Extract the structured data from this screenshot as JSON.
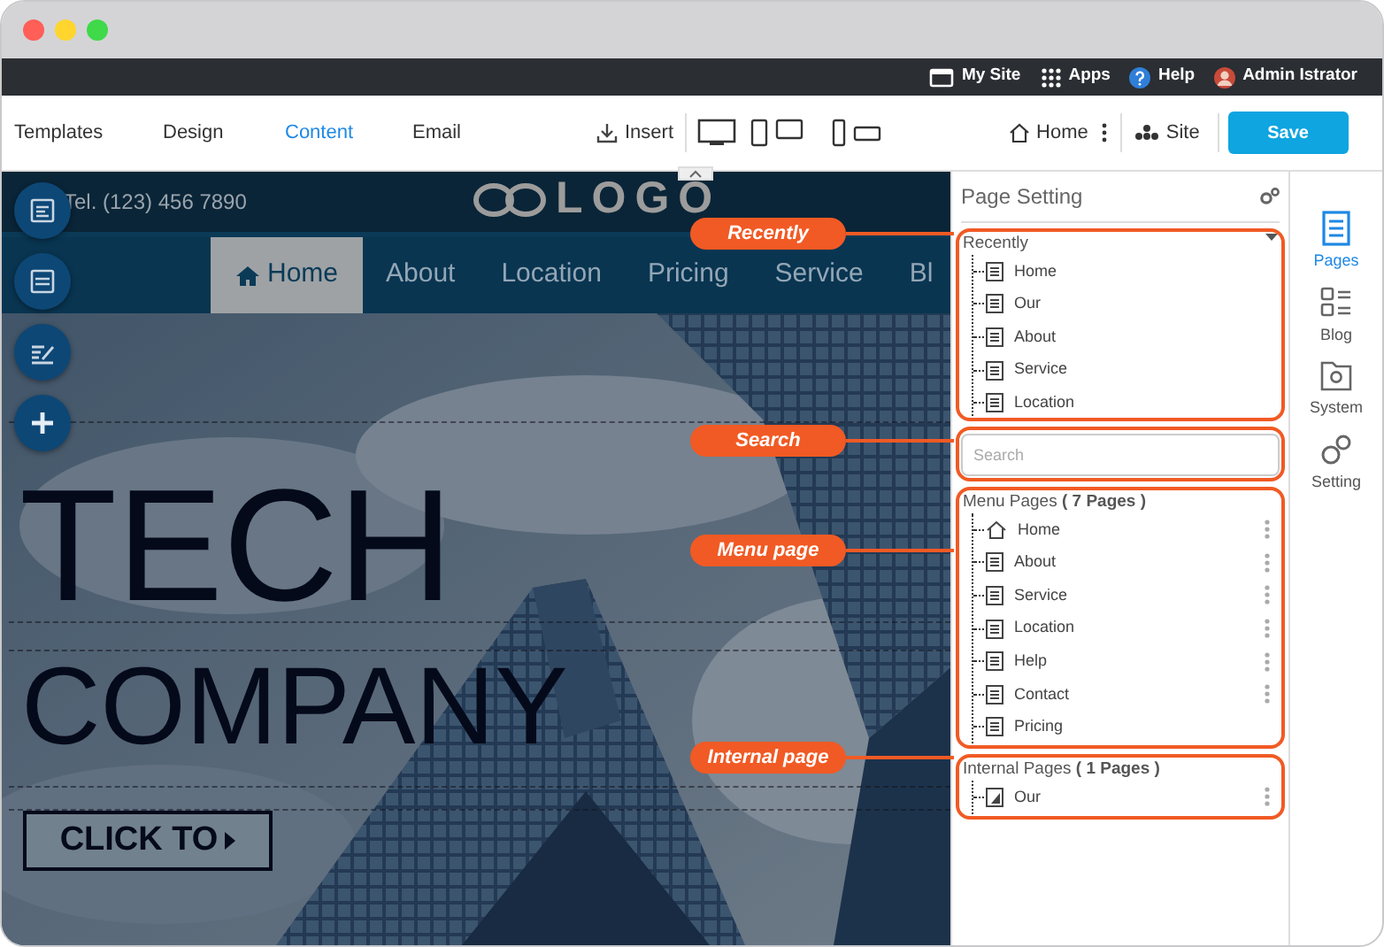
{
  "topbar": [
    {
      "kind": "site",
      "label": "My Site"
    },
    {
      "kind": "apps",
      "label": "Apps"
    },
    {
      "kind": "help",
      "label": "Help"
    },
    {
      "kind": "user",
      "label": "Admin Istrator"
    }
  ],
  "toolbar": {
    "tabs": [
      {
        "label": "Templates",
        "selected": false
      },
      {
        "label": "Design",
        "selected": false
      },
      {
        "label": "Content",
        "selected": true
      },
      {
        "label": "Email",
        "selected": false
      }
    ],
    "insert": "Insert",
    "home": "Home",
    "site": "Site",
    "save": "Save"
  },
  "canvas": {
    "phone": "Tel. (123) 456 7890",
    "logo": "LOGO",
    "nav": [
      {
        "label": "Home",
        "selected": true
      },
      {
        "label": "About",
        "selected": false
      },
      {
        "label": "Location",
        "selected": false
      },
      {
        "label": "Pricing",
        "selected": false
      },
      {
        "label": "Service",
        "selected": false
      },
      {
        "label": "Bl",
        "selected": false
      }
    ],
    "headline": [
      "TECH",
      "COMPANY"
    ],
    "cta": "CLICK TO"
  },
  "tools": [
    {
      "kind": "form"
    },
    {
      "kind": "layout"
    },
    {
      "kind": "edit"
    },
    {
      "kind": "add"
    }
  ],
  "callouts": [
    {
      "label": "Recently"
    },
    {
      "label": "Search"
    },
    {
      "label": "Menu page"
    },
    {
      "label": "Internal page"
    }
  ],
  "panel": {
    "title": "Page Setting",
    "recently": {
      "title": "Recently",
      "items": [
        {
          "label": "Home",
          "kind": "page"
        },
        {
          "label": "Our",
          "kind": "page"
        },
        {
          "label": "About",
          "kind": "page"
        },
        {
          "label": "Service",
          "kind": "page"
        },
        {
          "label": "Location",
          "kind": "page"
        }
      ]
    },
    "search": {
      "placeholder": "Search"
    },
    "menu": {
      "title": "Menu Pages **( 7 Pages )**",
      "items": [
        {
          "label": "Home",
          "kind": "home",
          "has_menu": true
        },
        {
          "label": "About",
          "kind": "page",
          "has_menu": true
        },
        {
          "label": "Service",
          "kind": "page",
          "has_menu": true
        },
        {
          "label": "Location",
          "kind": "page",
          "has_menu": true
        },
        {
          "label": "Help",
          "kind": "page",
          "has_menu": true
        },
        {
          "label": "Contact",
          "kind": "page",
          "has_menu": true
        },
        {
          "label": "Pricing",
          "kind": "page",
          "has_menu": false
        }
      ]
    },
    "internal": {
      "title": "Internal Pages **( 1 Pages )**",
      "items": [
        {
          "label": "Our",
          "kind": "internal",
          "has_menu": true
        }
      ]
    }
  },
  "rail": [
    {
      "kind": "pages",
      "label": "Pages",
      "selected": true
    },
    {
      "kind": "blog",
      "label": "Blog",
      "selected": false
    },
    {
      "kind": "system",
      "label": "System",
      "selected": false
    },
    {
      "kind": "setting",
      "label": "Setting",
      "selected": false
    }
  ]
}
